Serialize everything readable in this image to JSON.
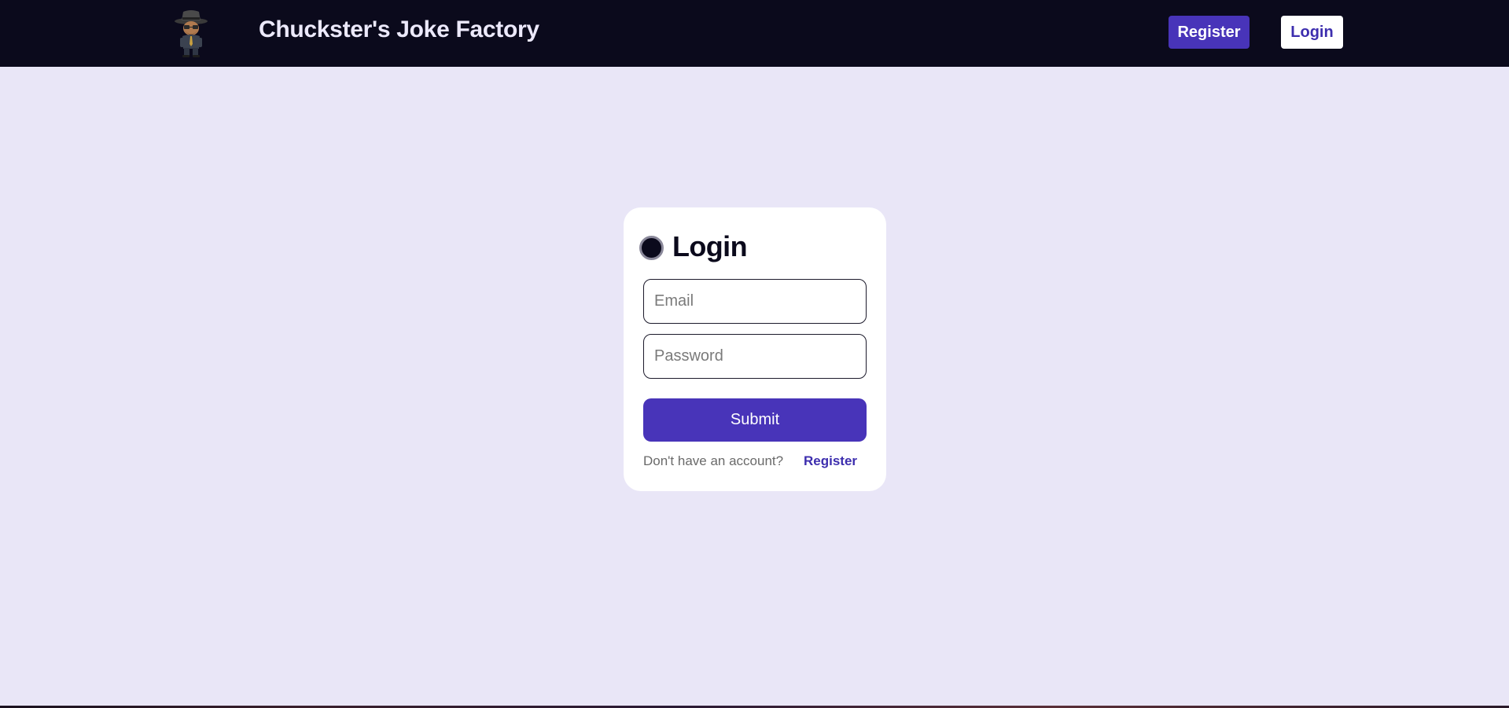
{
  "header": {
    "brand_title": "Chuckster's Joke Factory",
    "logo_icon": "detective-character-icon",
    "register_label": "Register",
    "login_label": "Login"
  },
  "login_card": {
    "title": "Login",
    "status_icon": "status-dot-icon",
    "email": {
      "placeholder": "Email",
      "value": ""
    },
    "password": {
      "placeholder": "Password",
      "value": ""
    },
    "submit_label": "Submit",
    "footer_text": "Don't have an account?",
    "footer_link_label": "Register"
  },
  "colors": {
    "page_background": "#e9e6f7",
    "navbar_background": "#0b0a1c",
    "accent": "#4834b9",
    "card_background": "#ffffff"
  }
}
